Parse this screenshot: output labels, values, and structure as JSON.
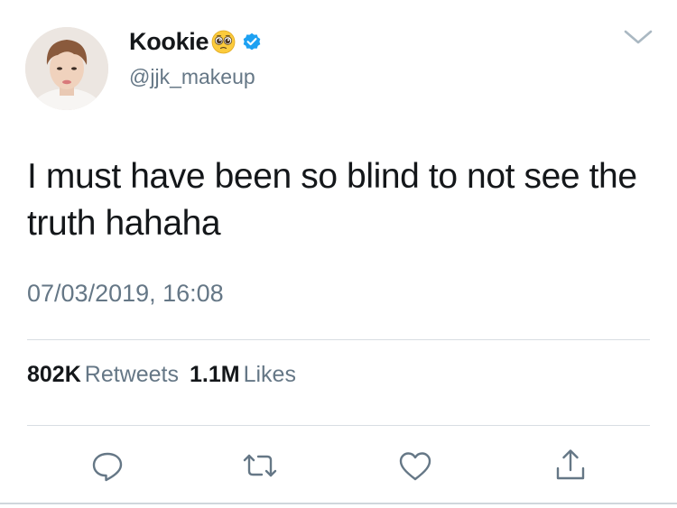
{
  "tweet": {
    "display_name": "Kookie",
    "handle": "@jjk_makeup",
    "name_emoji": "pleading-face",
    "verified": true,
    "text": "I must have been so blind to not see the truth hahaha",
    "timestamp": "07/03/2019, 16:08"
  },
  "stats": {
    "retweets_count": "802K",
    "retweets_label": "Retweets",
    "likes_count": "1.1M",
    "likes_label": "Likes"
  },
  "icons": {
    "reply": "reply-icon",
    "retweet": "retweet-icon",
    "like": "heart-icon",
    "share": "share-icon",
    "menu": "chevron-down-icon",
    "verified": "verified-badge-icon"
  },
  "colors": {
    "text": "#14171a",
    "secondary": "#657786",
    "verified": "#1da1f2",
    "divider": "#d8dee3"
  }
}
